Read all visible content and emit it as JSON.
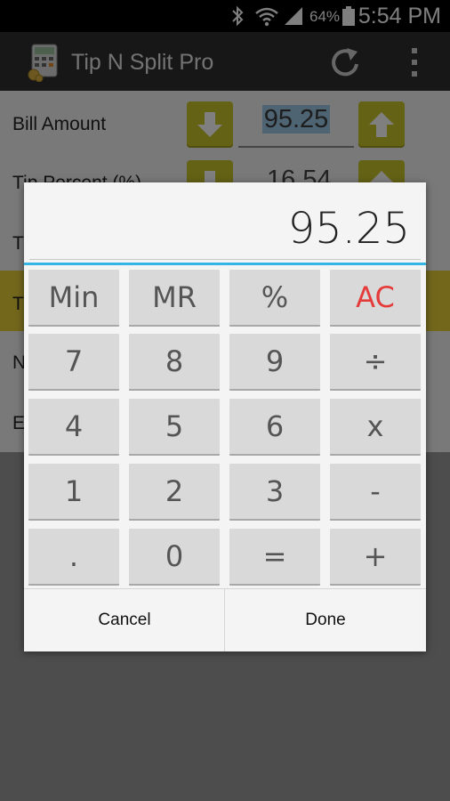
{
  "status_bar": {
    "battery_percent": "64%",
    "time": "5:54 PM"
  },
  "action_bar": {
    "title": "Tip N Split Pro"
  },
  "form": {
    "rows": [
      {
        "label": "Bill Amount"
      },
      {
        "label": "Tip Percent (%)"
      },
      {
        "label": "T"
      },
      {
        "label": "T"
      },
      {
        "label": "N"
      },
      {
        "label": "E"
      }
    ],
    "bill_amount": "95.25",
    "tip_percent": "16.54"
  },
  "colors": {
    "accent": "#33b5e5",
    "arrow_button": "#c9c42a",
    "highlight_row": "#e6cf39",
    "ac_key": "#e53b3b"
  },
  "calculator": {
    "display": "95.25",
    "keys": [
      [
        "Min",
        "MR",
        "%",
        "AC"
      ],
      [
        "7",
        "8",
        "9",
        "÷"
      ],
      [
        "4",
        "5",
        "6",
        "x"
      ],
      [
        "1",
        "2",
        "3",
        "-"
      ],
      [
        ".",
        "0",
        "=",
        "+"
      ]
    ],
    "cancel_label": "Cancel",
    "done_label": "Done"
  }
}
